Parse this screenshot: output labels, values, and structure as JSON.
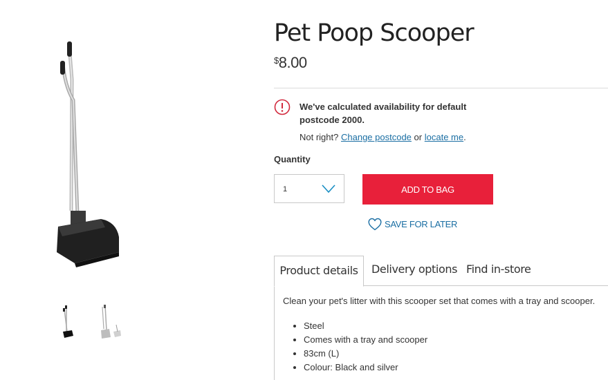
{
  "product": {
    "title": "Pet Poop Scooper",
    "price_currency": "$",
    "price_amount": "8.00"
  },
  "availability": {
    "icon": "alert-circle-icon",
    "message": "We've calculated availability for default postcode 2000.",
    "prompt": "Not right?",
    "change_link": "Change postcode",
    "or_text": "or",
    "locate_link": "locate me",
    "end_punct": "."
  },
  "quantity": {
    "label": "Quantity",
    "value": "1"
  },
  "actions": {
    "add_to_bag": "ADD TO BAG",
    "save_for_later": "SAVE FOR LATER"
  },
  "tabs": [
    {
      "label": "Product details",
      "active": true
    },
    {
      "label": "Delivery options",
      "active": false
    },
    {
      "label": "Find in-store",
      "active": false
    }
  ],
  "details": {
    "description": "Clean your pet's litter with this scooper set that comes with a tray and scooper.",
    "features": [
      "Steel",
      "Comes with a tray and scooper",
      "83cm (L)",
      "Colour: Black and silver"
    ]
  },
  "colors": {
    "accent_red": "#e8203a",
    "link_blue": "#1a6ea3",
    "alert_red": "#d1283c"
  }
}
